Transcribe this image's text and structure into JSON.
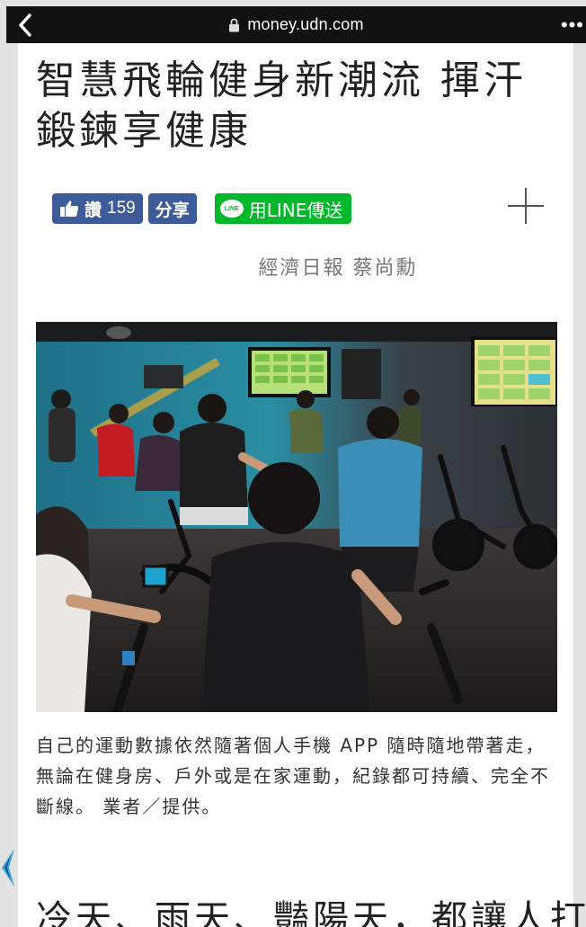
{
  "browser": {
    "url": "money.udn.com",
    "back_icon": "chevron-left-icon",
    "lock_icon": "lock-icon",
    "more_label": "•••"
  },
  "article": {
    "title": "智慧飛輪健身新潮流 揮汗鍛鍊享健康",
    "byline": "經濟日報 蔡尚勳",
    "photo_caption": "自己的運動數據依然隨著個人手機 APP 隨時隨地帶著走，無論在健身房、戶外或是在家運動，紀錄都可持續、完全不斷線。 業者／提供。",
    "body_first_line": "冷天、雨天、豔陽天，都讓人打消"
  },
  "share": {
    "like_label": "讚",
    "like_count": "159",
    "share_label": "分享",
    "line_logo_text": "LINE",
    "line_label": "用LINE傳送",
    "plus_icon": "plus-icon"
  },
  "colors": {
    "facebook": "#3e5b99",
    "line": "#00b82a",
    "topbar": "#111111"
  }
}
